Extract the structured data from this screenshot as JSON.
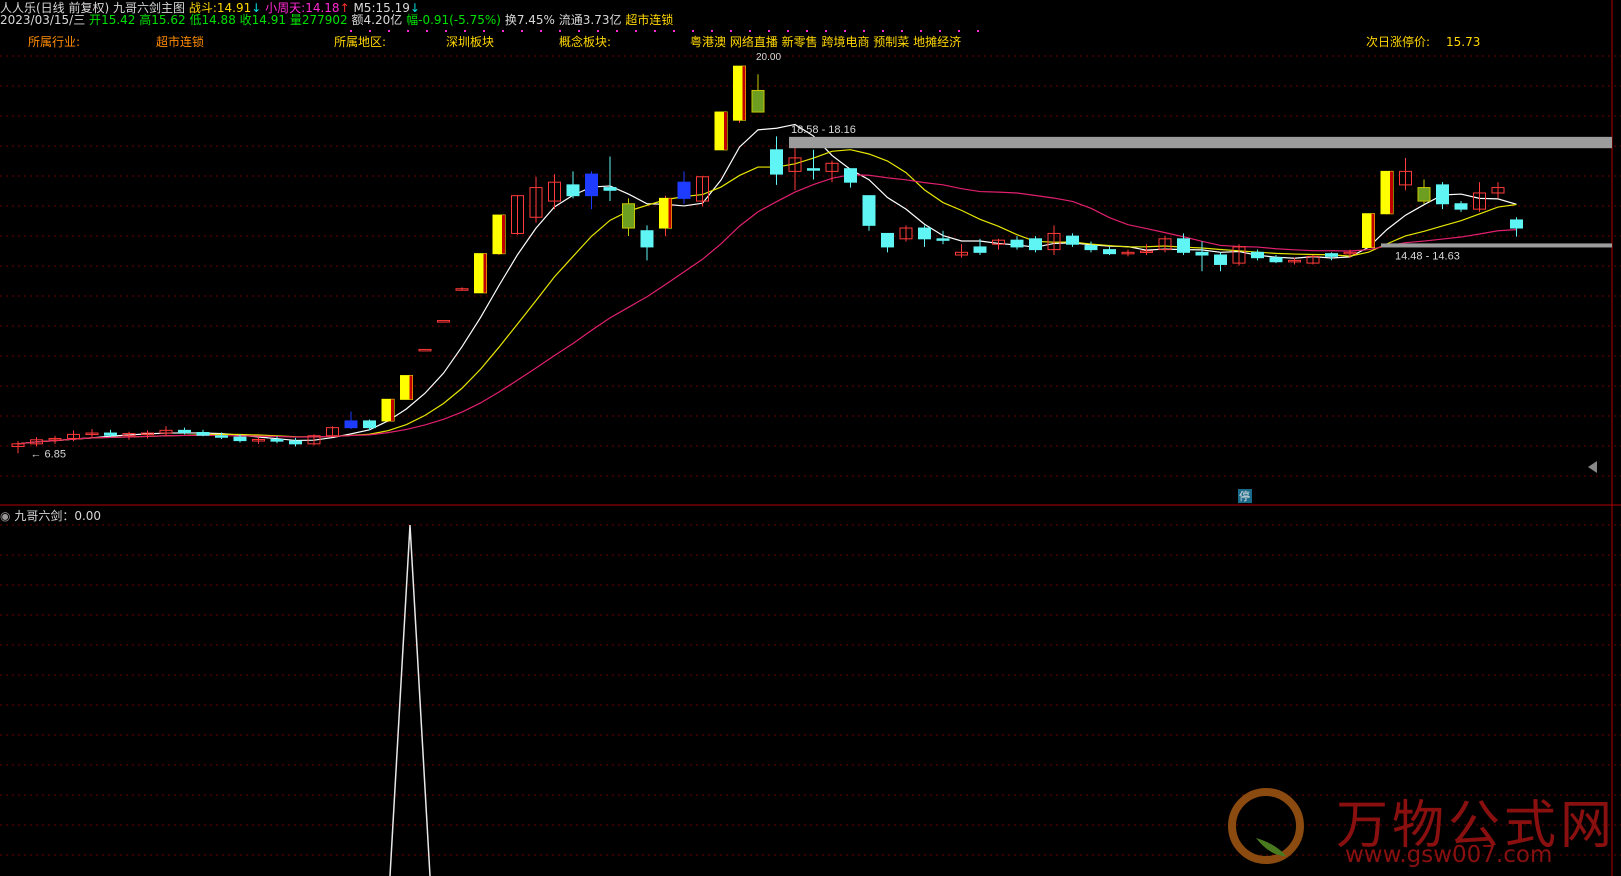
{
  "header": {
    "stock": "人人乐(日线 前复权)",
    "indicator_main": "九哥六剑主图",
    "zhandou_label": "战斗:",
    "zhandou_value": "14.91",
    "xiaozhoutian_label": "小周天:",
    "xiaozhoutian_value": "14.18",
    "m5_label": "M5:",
    "m5_value": "15.19",
    "date": "2023/03/15/三",
    "open_label": "开",
    "open": "15.42",
    "high_label": "高",
    "high": "15.62",
    "low_label": "低",
    "low": "14.88",
    "close_label": "收",
    "close": "14.91",
    "vol_label": "量",
    "vol": "277902",
    "amount_label": "额",
    "amount": "4.20亿",
    "chg_label": "幅",
    "chg": "-0.91(-5.75%)",
    "turnover_label": "换",
    "turnover": "7.45%",
    "float_label": "流通",
    "float": "3.73亿",
    "sector": "超市连锁"
  },
  "info": {
    "industry_label": "所属行业:",
    "industry": "超市连锁",
    "region_label": "所属地区:",
    "region": "深圳板块",
    "concept_label": "概念板块:",
    "concept": "粤港澳 网络直播 新零售 跨境电商 预制菜 地摊经济",
    "limit_label": "次日涨停价:",
    "limit": "15.73"
  },
  "annotations": {
    "low_mark": "6.85",
    "box1": "18.58 - 18.16",
    "box2": "14.48 - 14.63",
    "top_label": "20.00",
    "stop_badge": "停"
  },
  "sub": {
    "title": "九哥六剑：0.00"
  },
  "watermark": {
    "text": "万物公式网",
    "url": "www.gsw007.com"
  },
  "colors": {
    "up": "#ff3a3a",
    "down": "#5ff5f5",
    "strong": "#ffff00",
    "ma5": "#ffffff",
    "ma10": "#e6e600",
    "ma20": "#e0206e"
  },
  "chart_data": {
    "type": "candlestick",
    "ylim": [
      5.6,
      21.8
    ],
    "candles": [
      {
        "o": 7.1,
        "h": 7.3,
        "l": 6.85,
        "c": 7.2,
        "t": "up"
      },
      {
        "o": 7.2,
        "h": 7.45,
        "l": 7.1,
        "c": 7.35,
        "t": "up"
      },
      {
        "o": 7.35,
        "h": 7.5,
        "l": 7.2,
        "c": 7.4,
        "t": "up"
      },
      {
        "o": 7.4,
        "h": 7.7,
        "l": 7.3,
        "c": 7.55,
        "t": "up"
      },
      {
        "o": 7.55,
        "h": 7.75,
        "l": 7.45,
        "c": 7.6,
        "t": "up"
      },
      {
        "o": 7.6,
        "h": 7.72,
        "l": 7.45,
        "c": 7.52,
        "t": "down"
      },
      {
        "o": 7.5,
        "h": 7.65,
        "l": 7.35,
        "c": 7.58,
        "t": "up"
      },
      {
        "o": 7.55,
        "h": 7.7,
        "l": 7.4,
        "c": 7.6,
        "t": "up"
      },
      {
        "o": 7.6,
        "h": 7.85,
        "l": 7.5,
        "c": 7.7,
        "t": "up"
      },
      {
        "o": 7.7,
        "h": 7.8,
        "l": 7.55,
        "c": 7.62,
        "t": "down"
      },
      {
        "o": 7.62,
        "h": 7.72,
        "l": 7.48,
        "c": 7.52,
        "t": "down"
      },
      {
        "o": 7.5,
        "h": 7.62,
        "l": 7.38,
        "c": 7.45,
        "t": "down"
      },
      {
        "o": 7.45,
        "h": 7.55,
        "l": 7.25,
        "c": 7.32,
        "t": "down"
      },
      {
        "o": 7.32,
        "h": 7.45,
        "l": 7.2,
        "c": 7.36,
        "t": "up"
      },
      {
        "o": 7.36,
        "h": 7.48,
        "l": 7.22,
        "c": 7.3,
        "t": "down"
      },
      {
        "o": 7.3,
        "h": 7.42,
        "l": 7.1,
        "c": 7.2,
        "t": "down"
      },
      {
        "o": 7.2,
        "h": 7.55,
        "l": 7.15,
        "c": 7.5,
        "t": "up"
      },
      {
        "o": 7.5,
        "h": 7.85,
        "l": 7.45,
        "c": 7.8,
        "t": "up"
      },
      {
        "o": 7.8,
        "h": 8.4,
        "l": 7.75,
        "c": 8.05,
        "t": "blue"
      },
      {
        "o": 7.8,
        "h": 8.1,
        "l": 7.7,
        "c": 8.05,
        "t": "down"
      },
      {
        "o": 8.05,
        "h": 8.85,
        "l": 8.0,
        "c": 8.85,
        "t": "strong"
      },
      {
        "o": 8.85,
        "h": 9.73,
        "l": 8.85,
        "c": 9.73,
        "t": "strong"
      },
      {
        "o": 10.7,
        "h": 10.7,
        "l": 10.7,
        "c": 10.7,
        "t": "up"
      },
      {
        "o": 11.77,
        "h": 11.77,
        "l": 11.77,
        "c": 11.77,
        "t": "up"
      },
      {
        "o": 12.95,
        "h": 13.0,
        "l": 12.9,
        "c": 12.95,
        "t": "up"
      },
      {
        "o": 12.8,
        "h": 14.25,
        "l": 12.8,
        "c": 14.25,
        "t": "strong"
      },
      {
        "o": 14.25,
        "h": 15.68,
        "l": 14.2,
        "c": 15.68,
        "t": "strong"
      },
      {
        "o": 15.0,
        "h": 16.4,
        "l": 14.95,
        "c": 16.4,
        "t": "up"
      },
      {
        "o": 15.6,
        "h": 17.1,
        "l": 15.4,
        "c": 16.7,
        "t": "up"
      },
      {
        "o": 16.2,
        "h": 17.2,
        "l": 15.9,
        "c": 16.9,
        "t": "up"
      },
      {
        "o": 16.8,
        "h": 17.3,
        "l": 16.3,
        "c": 16.4,
        "t": "down"
      },
      {
        "o": 16.4,
        "h": 17.3,
        "l": 15.9,
        "c": 17.2,
        "t": "blue"
      },
      {
        "o": 16.7,
        "h": 17.85,
        "l": 16.2,
        "c": 16.6,
        "t": "down"
      },
      {
        "o": 16.1,
        "h": 16.3,
        "l": 14.9,
        "c": 15.2,
        "t": "strong2"
      },
      {
        "o": 14.5,
        "h": 15.3,
        "l": 14.0,
        "c": 15.1,
        "t": "down"
      },
      {
        "o": 15.2,
        "h": 16.4,
        "l": 14.9,
        "c": 16.3,
        "t": "strong"
      },
      {
        "o": 16.3,
        "h": 17.3,
        "l": 16.1,
        "c": 16.9,
        "t": "blue"
      },
      {
        "o": 16.2,
        "h": 17.1,
        "l": 16.0,
        "c": 17.1,
        "t": "up"
      },
      {
        "o": 18.1,
        "h": 19.5,
        "l": 18.1,
        "c": 19.5,
        "t": "strong"
      },
      {
        "o": 19.2,
        "h": 21.2,
        "l": 19.1,
        "c": 21.2,
        "t": "strong"
      },
      {
        "o": 20.3,
        "h": 20.9,
        "l": 19.5,
        "c": 19.5,
        "t": "strong2"
      },
      {
        "o": 18.1,
        "h": 18.6,
        "l": 16.8,
        "c": 17.2,
        "t": "down"
      },
      {
        "o": 17.3,
        "h": 18.2,
        "l": 16.6,
        "c": 17.8,
        "t": "up"
      },
      {
        "o": 17.4,
        "h": 18.1,
        "l": 17.0,
        "c": 17.35,
        "t": "down"
      },
      {
        "o": 17.3,
        "h": 17.7,
        "l": 16.9,
        "c": 17.6,
        "t": "up"
      },
      {
        "o": 17.4,
        "h": 17.4,
        "l": 16.7,
        "c": 16.9,
        "t": "down"
      },
      {
        "o": 16.4,
        "h": 16.4,
        "l": 15.1,
        "c": 15.3,
        "t": "down"
      },
      {
        "o": 15.0,
        "h": 15.0,
        "l": 14.3,
        "c": 14.5,
        "t": "down"
      },
      {
        "o": 14.8,
        "h": 15.3,
        "l": 14.7,
        "c": 15.2,
        "t": "up"
      },
      {
        "o": 15.2,
        "h": 15.3,
        "l": 14.5,
        "c": 14.8,
        "t": "down"
      },
      {
        "o": 14.8,
        "h": 15.1,
        "l": 14.6,
        "c": 14.8,
        "t": "down"
      },
      {
        "o": 14.2,
        "h": 14.6,
        "l": 14.1,
        "c": 14.3,
        "t": "up"
      },
      {
        "o": 14.3,
        "h": 14.8,
        "l": 14.2,
        "c": 14.5,
        "t": "down"
      },
      {
        "o": 14.6,
        "h": 14.8,
        "l": 14.4,
        "c": 14.75,
        "t": "up"
      },
      {
        "o": 14.75,
        "h": 14.9,
        "l": 14.4,
        "c": 14.5,
        "t": "down"
      },
      {
        "o": 14.8,
        "h": 14.9,
        "l": 14.3,
        "c": 14.4,
        "t": "down"
      },
      {
        "o": 14.4,
        "h": 15.3,
        "l": 14.2,
        "c": 15.0,
        "t": "up"
      },
      {
        "o": 14.9,
        "h": 15.0,
        "l": 14.5,
        "c": 14.6,
        "t": "down"
      },
      {
        "o": 14.55,
        "h": 14.7,
        "l": 14.3,
        "c": 14.4,
        "t": "down"
      },
      {
        "o": 14.4,
        "h": 14.5,
        "l": 14.2,
        "c": 14.25,
        "t": "down"
      },
      {
        "o": 14.25,
        "h": 14.4,
        "l": 14.15,
        "c": 14.3,
        "t": "up"
      },
      {
        "o": 14.3,
        "h": 14.6,
        "l": 14.2,
        "c": 14.35,
        "t": "up"
      },
      {
        "o": 14.4,
        "h": 14.9,
        "l": 14.3,
        "c": 14.8,
        "t": "up"
      },
      {
        "o": 14.8,
        "h": 15.0,
        "l": 14.2,
        "c": 14.3,
        "t": "down"
      },
      {
        "o": 14.3,
        "h": 14.7,
        "l": 13.6,
        "c": 14.2,
        "t": "down"
      },
      {
        "o": 14.2,
        "h": 14.3,
        "l": 13.6,
        "c": 13.85,
        "t": "down"
      },
      {
        "o": 13.9,
        "h": 14.6,
        "l": 13.8,
        "c": 14.5,
        "t": "up"
      },
      {
        "o": 14.3,
        "h": 14.4,
        "l": 14.0,
        "c": 14.1,
        "t": "down"
      },
      {
        "o": 14.1,
        "h": 14.2,
        "l": 13.9,
        "c": 13.95,
        "t": "down"
      },
      {
        "o": 13.95,
        "h": 14.1,
        "l": 13.85,
        "c": 14.0,
        "t": "up"
      },
      {
        "o": 13.9,
        "h": 14.2,
        "l": 13.85,
        "c": 14.15,
        "t": "up"
      },
      {
        "o": 14.15,
        "h": 14.3,
        "l": 14.0,
        "c": 14.25,
        "t": "down"
      },
      {
        "o": 14.25,
        "h": 14.4,
        "l": 14.1,
        "c": 14.3,
        "t": "up"
      },
      {
        "o": 14.48,
        "h": 15.73,
        "l": 14.45,
        "c": 15.73,
        "t": "strong"
      },
      {
        "o": 15.73,
        "h": 17.3,
        "l": 15.7,
        "c": 17.3,
        "t": "strong"
      },
      {
        "o": 17.3,
        "h": 17.8,
        "l": 16.6,
        "c": 16.8,
        "t": "up"
      },
      {
        "o": 16.7,
        "h": 17.0,
        "l": 16.1,
        "c": 16.2,
        "t": "strong2"
      },
      {
        "o": 16.8,
        "h": 16.9,
        "l": 15.9,
        "c": 16.1,
        "t": "down"
      },
      {
        "o": 16.1,
        "h": 16.2,
        "l": 15.8,
        "c": 15.9,
        "t": "down"
      },
      {
        "o": 15.9,
        "h": 16.9,
        "l": 15.8,
        "c": 16.5,
        "t": "up"
      },
      {
        "o": 16.5,
        "h": 16.9,
        "l": 16.3,
        "c": 16.7,
        "t": "up"
      },
      {
        "o": 15.5,
        "h": 15.6,
        "l": 14.88,
        "c": 15.2,
        "t": "down"
      }
    ],
    "sub_values": [
      0,
      0,
      0,
      0,
      0,
      0,
      0,
      0,
      0,
      0,
      0,
      0,
      0,
      0,
      0,
      0,
      0,
      0,
      0,
      0,
      0,
      0,
      0,
      0,
      0,
      0,
      0,
      0,
      0,
      0,
      0,
      0,
      0,
      0,
      0,
      0,
      0,
      0,
      0,
      0,
      0,
      0,
      0,
      0,
      0,
      0,
      0,
      0,
      0,
      0,
      0,
      0,
      0,
      0,
      0,
      0,
      0,
      0,
      0,
      0,
      0,
      0,
      0,
      0,
      0,
      0,
      0,
      0,
      0,
      0,
      0,
      0,
      0,
      0,
      0,
      0,
      0,
      0,
      0,
      0,
      0,
      0
    ]
  }
}
